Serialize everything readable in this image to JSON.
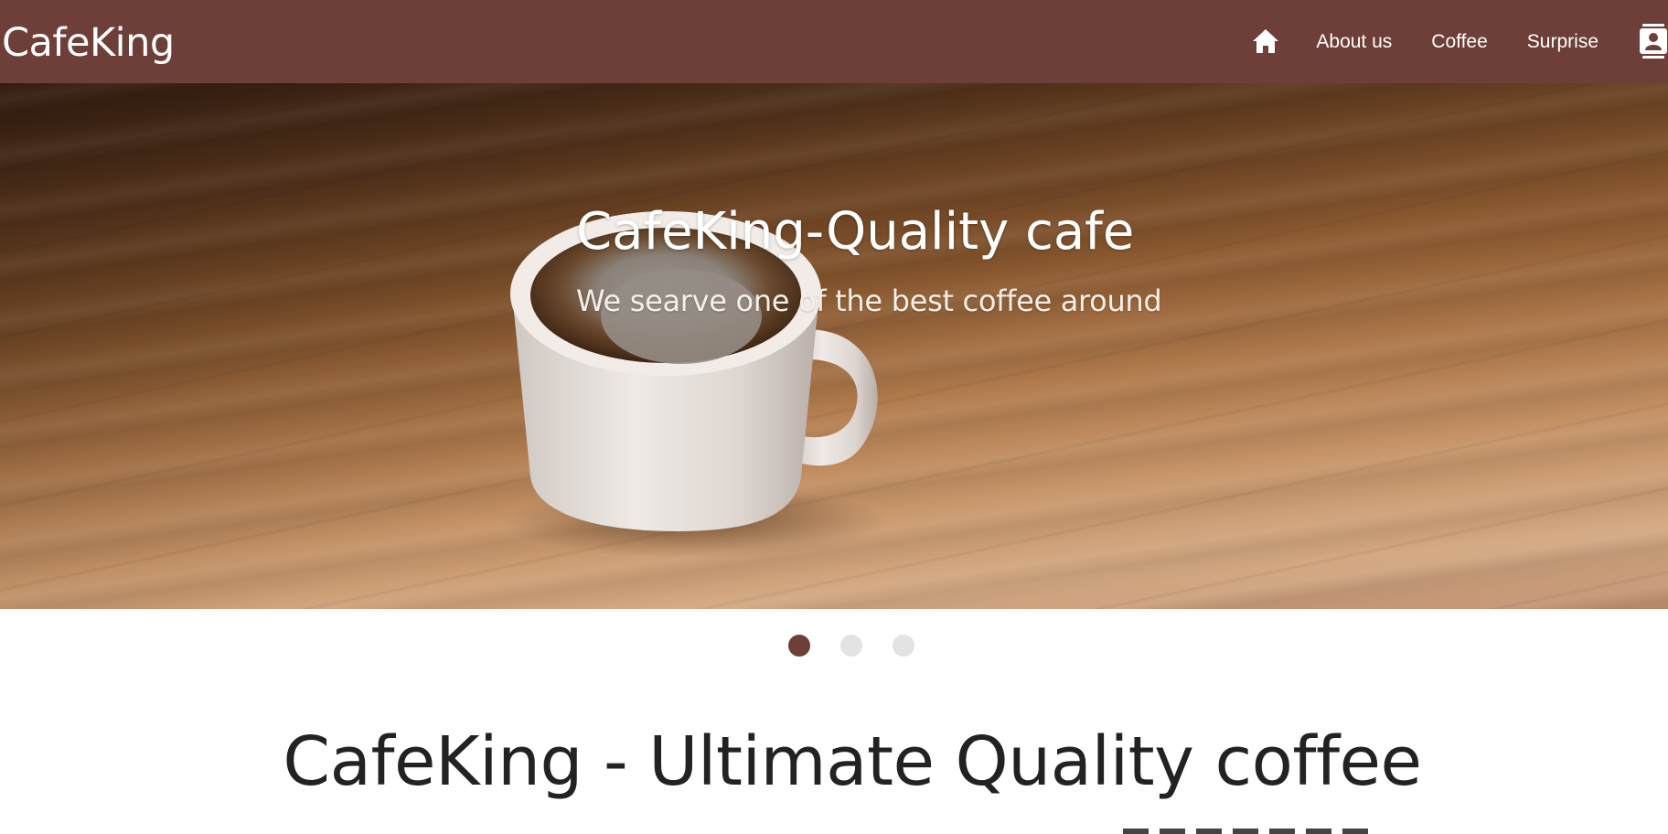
{
  "navbar": {
    "brand": "CafeKing",
    "home_icon": "home-icon",
    "links": [
      "About us",
      "Coffee",
      "Surprise"
    ],
    "contact_icon": "contact-book-icon",
    "background_color": "#6e3e38"
  },
  "hero": {
    "title": "CafeKing-Quality cafe",
    "subtitle": "We searve one of the best coffee around",
    "image_subject": "coffee-cup-on-wooden-table",
    "indicators": {
      "count": 3,
      "active_index": 0,
      "active_color": "#6e3e38",
      "inactive_color": "#e3e3e3"
    }
  },
  "main": {
    "heading": "CafeKing - Ultimate Quality coffee"
  }
}
